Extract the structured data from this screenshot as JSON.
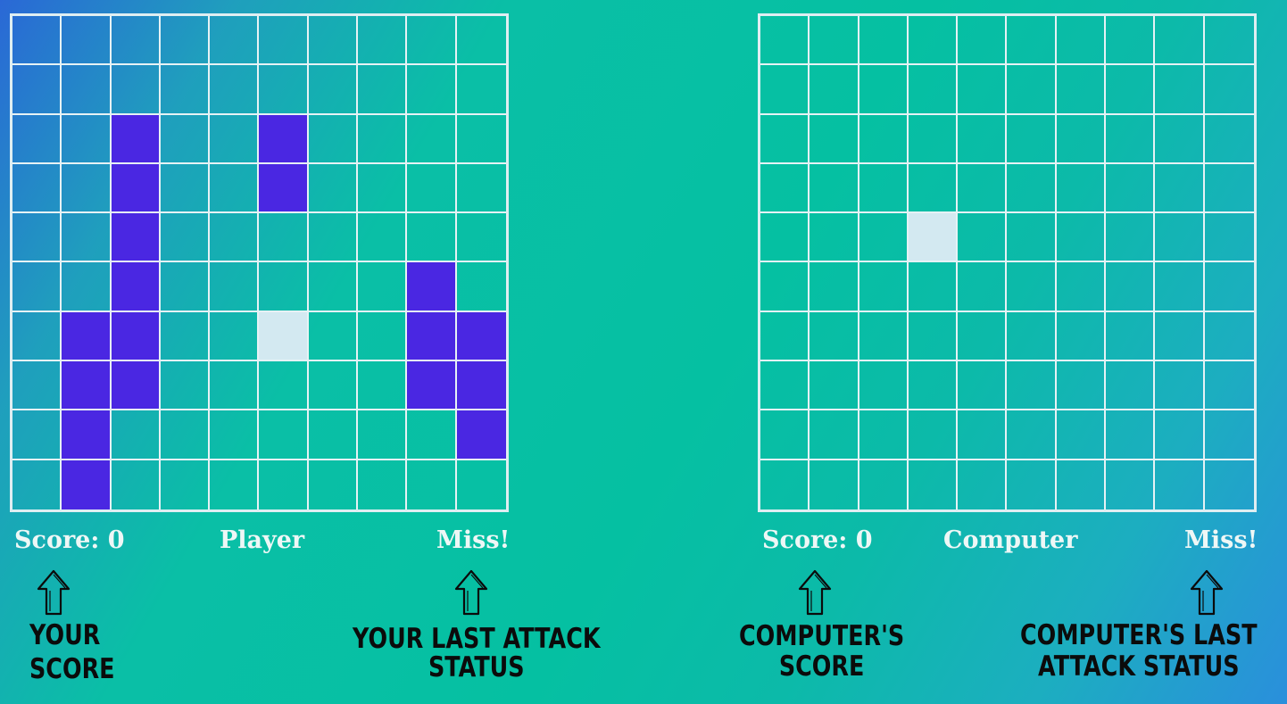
{
  "player_board": {
    "label": "Player",
    "score": "Score: 0",
    "status": "Miss!",
    "ship_cells": [
      [
        2,
        2
      ],
      [
        3,
        2
      ],
      [
        4,
        2
      ],
      [
        5,
        2
      ],
      [
        6,
        2
      ],
      [
        7,
        2
      ],
      [
        2,
        5
      ],
      [
        3,
        5
      ],
      [
        6,
        1
      ],
      [
        7,
        1
      ],
      [
        8,
        1
      ],
      [
        9,
        1
      ],
      [
        5,
        8
      ],
      [
        6,
        8
      ],
      [
        7,
        8
      ],
      [
        6,
        9
      ],
      [
        7,
        9
      ],
      [
        8,
        9
      ]
    ],
    "miss_cells": [
      [
        6,
        5
      ]
    ]
  },
  "computer_board": {
    "label": "Computer",
    "score": "Score: 0",
    "status": "Miss!",
    "ship_cells": [],
    "miss_cells": [
      [
        4,
        3
      ]
    ]
  },
  "annotations": {
    "your_score": [
      "YOUR",
      "SCORE"
    ],
    "your_last_attack": [
      "YOUR LAST ATTACK",
      "STATUS"
    ],
    "computer_score": [
      "COMPUTER'S",
      "SCORE"
    ],
    "computer_last_attack": [
      "COMPUTER'S LAST",
      "ATTACK STATUS"
    ]
  },
  "colors": {
    "ship": "#4a27e2",
    "miss": "#d3e9f1",
    "grid_line": "#e6f2f5"
  },
  "icons": {
    "pointer": "up-arrow-icon"
  }
}
